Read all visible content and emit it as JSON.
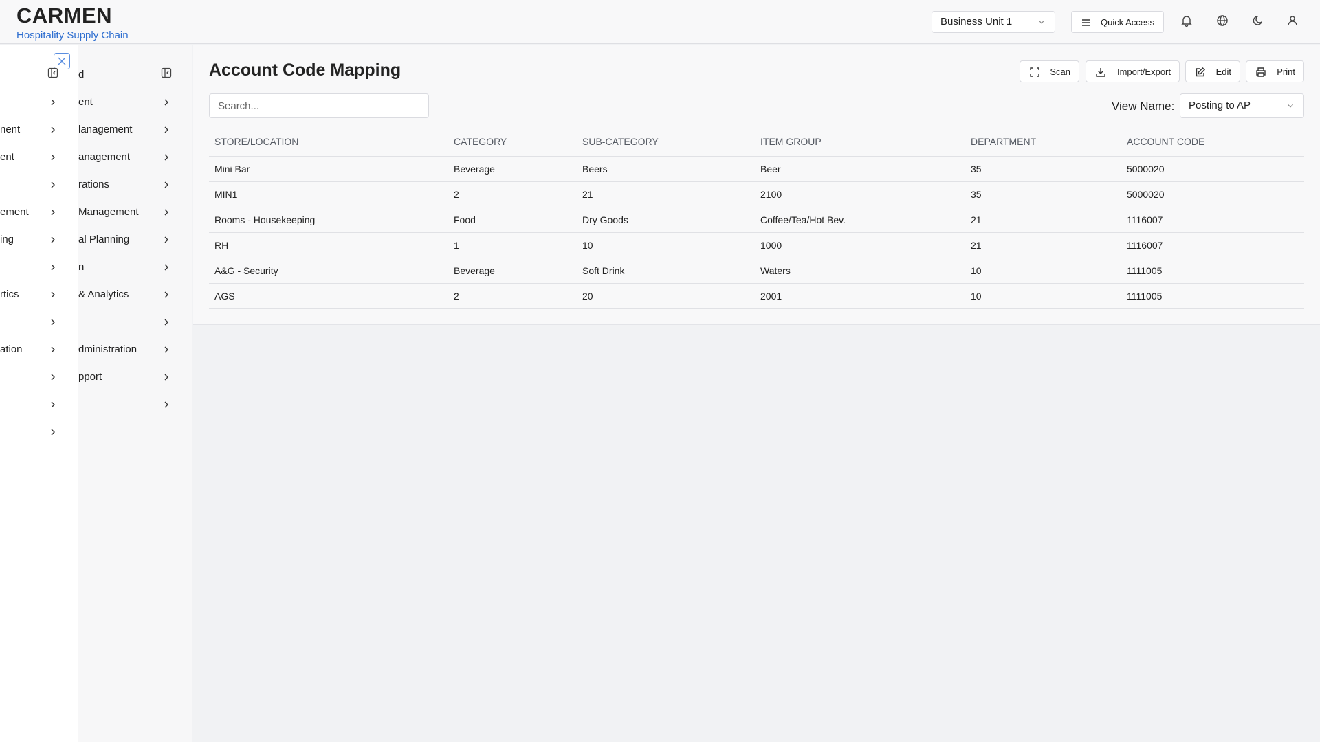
{
  "header": {
    "brand_title": "CARMEN",
    "brand_subtitle": "Hospitality Supply Chain",
    "business_unit": "Business Unit 1",
    "quick_access_label": "Quick Access"
  },
  "sidebar_outer": {
    "items": [
      {
        "label": ""
      },
      {
        "label": ""
      },
      {
        "label": "nent"
      },
      {
        "label": "ent"
      },
      {
        "label": ""
      },
      {
        "label": "ement"
      },
      {
        "label": "ing"
      },
      {
        "label": ""
      },
      {
        "label": "rtics"
      },
      {
        "label": ""
      },
      {
        "label": "ation"
      },
      {
        "label": ""
      },
      {
        "label": ""
      }
    ]
  },
  "sidebar_inner": {
    "items": [
      {
        "label": "d"
      },
      {
        "label": "ent"
      },
      {
        "label": "lanagement"
      },
      {
        "label": "anagement"
      },
      {
        "label": "rations"
      },
      {
        "label": "Management"
      },
      {
        "label": "al Planning"
      },
      {
        "label": "n"
      },
      {
        "label": "& Analytics"
      },
      {
        "label": ""
      },
      {
        "label": "dministration"
      },
      {
        "label": "pport"
      },
      {
        "label": ""
      }
    ]
  },
  "page": {
    "title": "Account Code Mapping",
    "buttons": {
      "scan": "Scan",
      "import_export": "Import/Export",
      "edit": "Edit",
      "print": "Print"
    },
    "search_placeholder": "Search...",
    "view_label": "View Name:",
    "view_value": "Posting to AP"
  },
  "table": {
    "columns": [
      "STORE/LOCATION",
      "CATEGORY",
      "SUB-CATEGORY",
      "ITEM GROUP",
      "DEPARTMENT",
      "ACCOUNT CODE"
    ],
    "rows": [
      [
        "Mini Bar",
        "Beverage",
        "Beers",
        "Beer",
        "35",
        "5000020"
      ],
      [
        "MIN1",
        "2",
        "21",
        "2100",
        "35",
        "5000020"
      ],
      [
        "Rooms - Housekeeping",
        "Food",
        "Dry Goods",
        "Coffee/Tea/Hot Bev.",
        "21",
        "1116007"
      ],
      [
        "RH",
        "1",
        "10",
        "1000",
        "21",
        "1116007"
      ],
      [
        "A&G - Security",
        "Beverage",
        "Soft Drink",
        "Waters",
        "10",
        "1111005"
      ],
      [
        "AGS",
        "2",
        "20",
        "2001",
        "10",
        "1111005"
      ]
    ]
  }
}
